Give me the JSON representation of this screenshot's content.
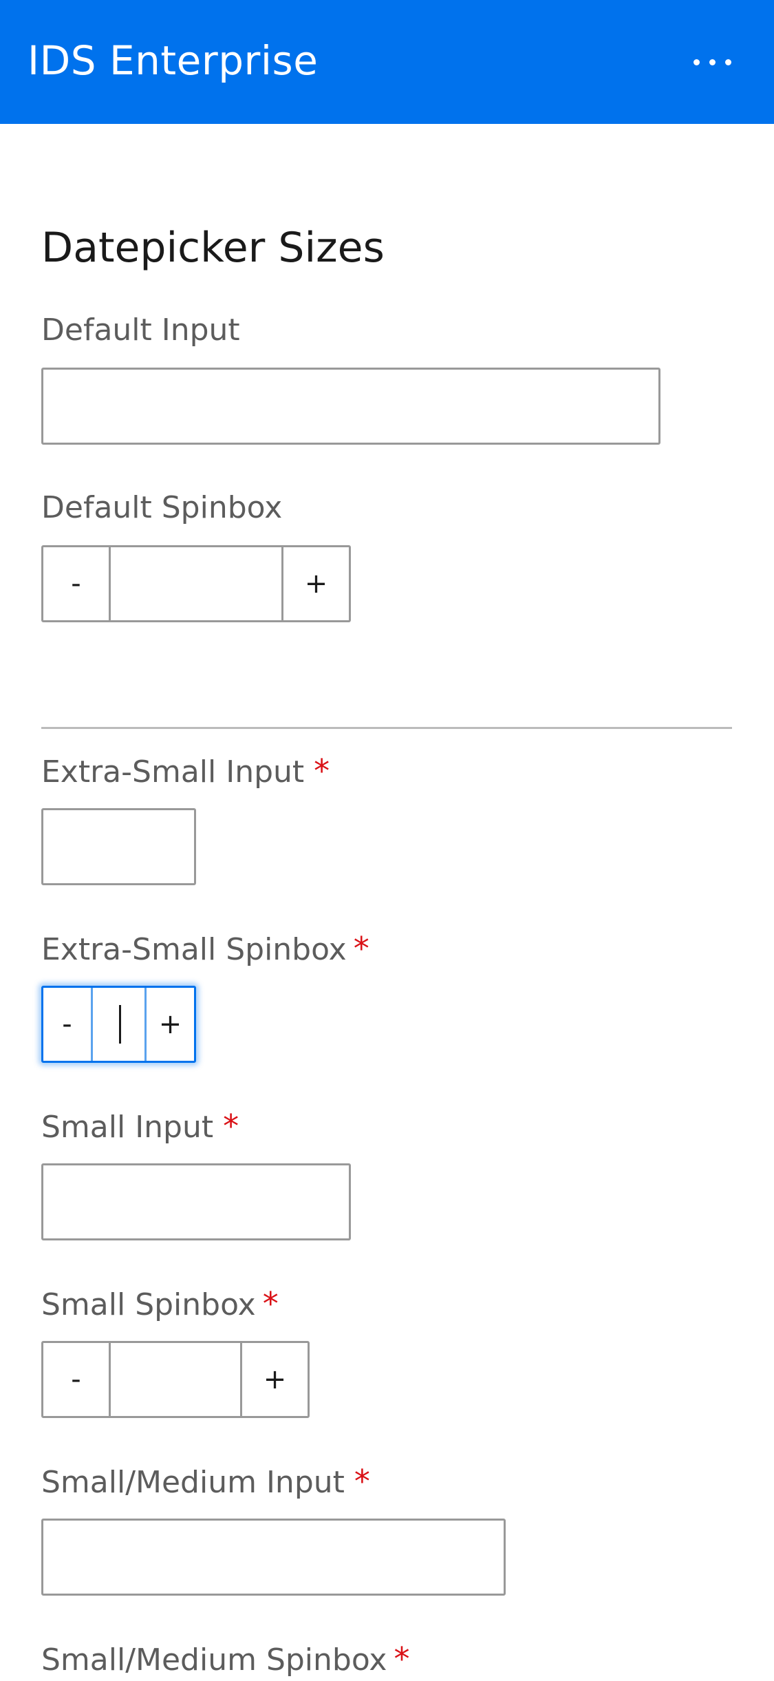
{
  "header": {
    "title": "IDS Enterprise",
    "more_icon": "more-horizontal-icon"
  },
  "page": {
    "title": "Datepicker Sizes"
  },
  "colors": {
    "header_bg": "#0072ed",
    "required": "#da1217",
    "focus": "#0072ed"
  },
  "fields": {
    "default_input": {
      "label": "Default Input",
      "value": ""
    },
    "default_spinbox": {
      "label": "Default Spinbox",
      "value": "",
      "decrement": "-",
      "increment": "+"
    },
    "xs_input": {
      "label": "Extra-Small Input",
      "required_mark": "*",
      "value": ""
    },
    "xs_spinbox": {
      "label": "Extra-Small Spinbox",
      "required_mark": "*",
      "value": "",
      "decrement": "-",
      "increment": "+"
    },
    "sm_input": {
      "label": "Small Input",
      "required_mark": "*",
      "value": ""
    },
    "sm_spinbox": {
      "label": "Small Spinbox",
      "required_mark": "*",
      "value": "",
      "decrement": "-",
      "increment": "+"
    },
    "smmd_input": {
      "label": "Small/Medium Input",
      "required_mark": "*",
      "value": ""
    },
    "smmd_spinbox": {
      "label": "Small/Medium Spinbox",
      "required_mark": "*"
    }
  }
}
